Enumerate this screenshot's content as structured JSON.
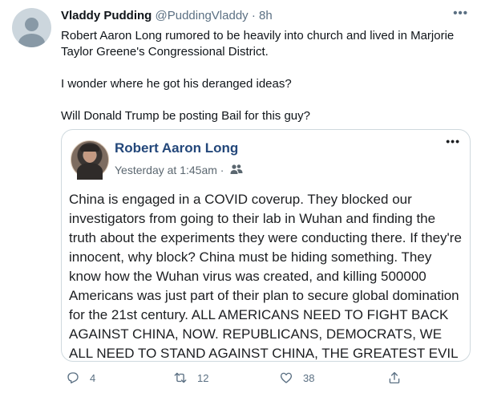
{
  "tweet": {
    "display_name": "Vladdy Pudding",
    "handle": "@PuddingVladdy",
    "separator": "·",
    "time": "8h",
    "more_glyph": "•••",
    "paragraphs": [
      "Robert Aaron Long rumored to be heavily into church and lived in Marjorie Taylor Greene's Congressional District.",
      "I wonder where he got his deranged ideas?",
      "Will Donald Trump be posting Bail for this guy?"
    ]
  },
  "card": {
    "name": "Robert Aaron Long",
    "time": "Yesterday at 1:45am",
    "separator": "·",
    "audience_icon": "friends-group-icon",
    "more_glyph": "•••",
    "body": "China is engaged in a COVID coverup. They blocked our investigators from going to their lab in Wuhan and finding the truth about the experiments they were conducting there. If they're innocent, why block? China must be hiding something. They know how the Wuhan virus was created, and killing 500000 Americans was just part of their plan to secure global domination for the 21st century. ALL AMERICANS NEED TO FIGHT BACK AGAINST CHINA, NOW. REPUBLICANS, DEMOCRATS, WE ALL NEED TO STAND AGAINST CHINA, THE GREATEST EVIL OF OUR"
  },
  "actions": {
    "reply_count": "4",
    "retweet_count": "12",
    "like_count": "38"
  },
  "colors": {
    "text": "#0f1419",
    "secondary": "#5b7083",
    "card_name": "#23477a",
    "border": "#cfd9de"
  }
}
